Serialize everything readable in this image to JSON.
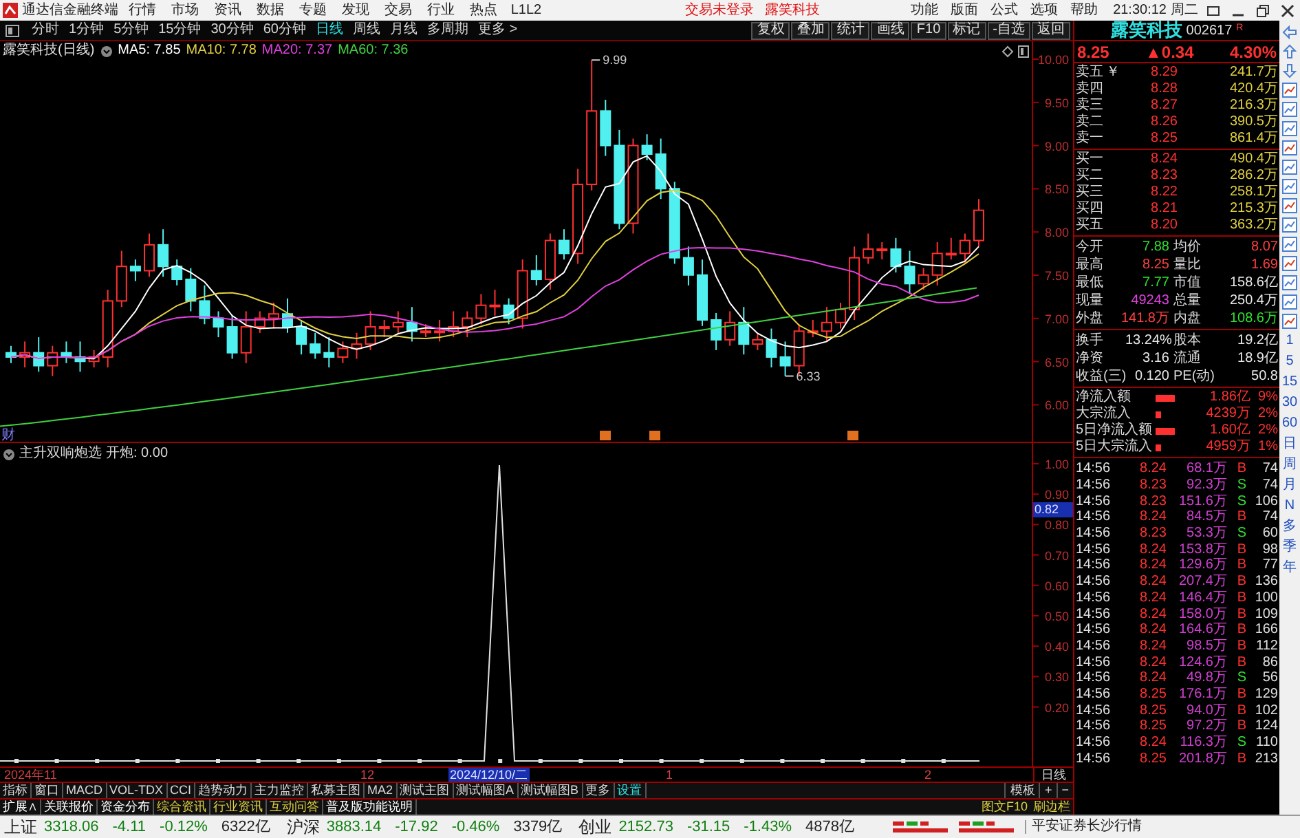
{
  "title_bar": {
    "app_title": "通达信金融终端",
    "menus": [
      "行情",
      "市场",
      "资讯",
      "数据",
      "专题",
      "发现",
      "交易",
      "行业",
      "热点",
      "L1L2"
    ],
    "trade_status": "交易未登录",
    "stock": "露笑科技",
    "right_menus": [
      "功能",
      "版面",
      "公式",
      "选项",
      "帮助"
    ],
    "time": "21:30:12",
    "weekday": "周二"
  },
  "period_tabs": [
    {
      "label": "分时",
      "selected": false
    },
    {
      "label": "1分钟",
      "selected": false
    },
    {
      "label": "5分钟",
      "selected": false
    },
    {
      "label": "15分钟",
      "selected": false
    },
    {
      "label": "30分钟",
      "selected": false
    },
    {
      "label": "60分钟",
      "selected": false
    },
    {
      "label": "日线",
      "selected": true
    },
    {
      "label": "周线",
      "selected": false
    },
    {
      "label": "月线",
      "selected": false
    },
    {
      "label": "多周期",
      "selected": false
    },
    {
      "label": "更多 >",
      "selected": false
    }
  ],
  "chart_tools": [
    "复权",
    "叠加",
    "统计",
    "画线",
    "F10",
    "标记",
    "-自选",
    "返回"
  ],
  "kline": {
    "title": "露笑科技(日线)",
    "ma": [
      {
        "label": "MA5: 7.85",
        "color": "#ffffff"
      },
      {
        "label": "MA10: 7.78",
        "color": "#e0d040"
      },
      {
        "label": "MA20: 7.37",
        "color": "#e040e0"
      },
      {
        "label": "MA60: 7.36",
        "color": "#40d040"
      }
    ],
    "high_label": "9.99",
    "low_label": "6.33",
    "price_axis": [
      "10.00",
      "9.50",
      "9.00",
      "8.50",
      "8.00",
      "7.50",
      "7.00",
      "6.50",
      "6.00"
    ],
    "marker": "财"
  },
  "indicator": {
    "title": "主升双响炮选",
    "reading": "开炮: 0.00",
    "axis": [
      "1.00",
      "0.90",
      "0.80",
      "0.70",
      "0.60",
      "0.50",
      "0.40",
      "0.30",
      "0.20"
    ],
    "cursor_value": "0.82"
  },
  "date_axis": {
    "year": "2024年",
    "months": [
      "11",
      "12",
      "1",
      "2"
    ],
    "cursor_date": "2024/12/10/二",
    "period": "日线"
  },
  "indicator_tabs": [
    {
      "label": "指标",
      "selected": false
    },
    {
      "label": "窗口",
      "selected": false
    },
    {
      "label": "MACD",
      "selected": false
    },
    {
      "label": "VOL-TDX",
      "selected": false
    },
    {
      "label": "CCI",
      "selected": false
    },
    {
      "label": "趋势动力",
      "selected": false
    },
    {
      "label": "主力监控",
      "selected": false
    },
    {
      "label": "私募主图",
      "selected": false
    },
    {
      "label": "MA2",
      "selected": false
    },
    {
      "label": "测试主图",
      "selected": false
    },
    {
      "label": "测试幅图A",
      "selected": false
    },
    {
      "label": "测试幅图B",
      "selected": false
    },
    {
      "label": "更多",
      "selected": false
    },
    {
      "label": "设置",
      "selected": true
    }
  ],
  "tab_buttons": [
    "模板",
    "+",
    "−"
  ],
  "info_tabs": [
    {
      "label": "扩展∧",
      "highlighted": false
    },
    {
      "label": "关联报价",
      "highlighted": false
    },
    {
      "label": "资金分布",
      "highlighted": false
    },
    {
      "label": "综合资讯",
      "highlighted": true
    },
    {
      "label": "行业资讯",
      "highlighted": true
    },
    {
      "label": "互动问答",
      "highlighted": true
    },
    {
      "label": "普及版功能说明",
      "highlighted": false
    }
  ],
  "info_right": [
    "图文F10",
    "刷边栏"
  ],
  "quote": {
    "name": "露笑科技",
    "code": "002617",
    "flag": "R",
    "price": "8.25",
    "change": "▲0.34",
    "percent": "4.30%",
    "currency": "￥",
    "asks": [
      {
        "label": "卖五",
        "price": "8.29",
        "volume": "241.7万"
      },
      {
        "label": "卖四",
        "price": "8.28",
        "volume": "420.4万"
      },
      {
        "label": "卖三",
        "price": "8.27",
        "volume": "216.3万"
      },
      {
        "label": "卖二",
        "price": "8.26",
        "volume": "390.5万"
      },
      {
        "label": "卖一",
        "price": "8.25",
        "volume": "861.4万"
      }
    ],
    "bids": [
      {
        "label": "买一",
        "price": "8.24",
        "volume": "490.4万"
      },
      {
        "label": "买二",
        "price": "8.23",
        "volume": "286.2万"
      },
      {
        "label": "买三",
        "price": "8.22",
        "volume": "258.1万"
      },
      {
        "label": "买四",
        "price": "8.21",
        "volume": "215.3万"
      },
      {
        "label": "买五",
        "price": "8.20",
        "volume": "363.2万"
      }
    ],
    "stats": [
      {
        "label": "今开",
        "value": "7.88",
        "color": "#30e030"
      },
      {
        "label": "均价",
        "value": "8.07",
        "color": "#ff4040"
      },
      {
        "label": "最高",
        "value": "8.25",
        "color": "#ff4040"
      },
      {
        "label": "量比",
        "value": "1.69",
        "color": "#ff4040"
      },
      {
        "label": "最低",
        "value": "7.77",
        "color": "#30e030"
      },
      {
        "label": "市值",
        "value": "158.6亿",
        "color": "#e8e8e8"
      },
      {
        "label": "现量",
        "value": "49243",
        "color": "#e040e0"
      },
      {
        "label": "总量",
        "value": "250.4万",
        "color": "#e8e8e8"
      },
      {
        "label": "外盘",
        "value": "141.8万",
        "color": "#ff4040"
      },
      {
        "label": "内盘",
        "value": "108.6万",
        "color": "#30e030"
      }
    ],
    "fundamentals": [
      {
        "label": "换手",
        "value": "13.24%",
        "label2": "股本",
        "value2": "19.2亿"
      },
      {
        "label": "净资",
        "value": "3.16",
        "label2": "流通",
        "value2": "18.9亿"
      },
      {
        "label": "收益(三)",
        "value": "0.120",
        "label2": "PE(动)",
        "value2": "50.8"
      }
    ],
    "flows": [
      {
        "label": "净流入额",
        "kind": "bar",
        "value": "1.86亿",
        "percent": "9%"
      },
      {
        "label": "大宗流入",
        "kind": "dot",
        "value": "4239万",
        "percent": "2%"
      },
      {
        "label": "5日净流入额",
        "kind": "bar",
        "value": "1.60亿",
        "percent": "2%"
      },
      {
        "label": "5日大宗流入",
        "kind": "dot",
        "value": "4959万",
        "percent": "1%"
      }
    ],
    "ticks": [
      {
        "time": "14:56",
        "price": "8.24",
        "volume": "68.1万",
        "side": "B",
        "count": "74"
      },
      {
        "time": "14:56",
        "price": "8.23",
        "volume": "92.3万",
        "side": "S",
        "count": "74"
      },
      {
        "time": "14:56",
        "price": "8.23",
        "volume": "151.6万",
        "side": "S",
        "count": "106"
      },
      {
        "time": "14:56",
        "price": "8.24",
        "volume": "84.5万",
        "side": "B",
        "count": "74"
      },
      {
        "time": "14:56",
        "price": "8.23",
        "volume": "53.3万",
        "side": "S",
        "count": "60"
      },
      {
        "time": "14:56",
        "price": "8.24",
        "volume": "153.8万",
        "side": "B",
        "count": "98"
      },
      {
        "time": "14:56",
        "price": "8.24",
        "volume": "129.6万",
        "side": "B",
        "count": "77"
      },
      {
        "time": "14:56",
        "price": "8.24",
        "volume": "207.4万",
        "side": "B",
        "count": "136"
      },
      {
        "time": "14:56",
        "price": "8.24",
        "volume": "146.4万",
        "side": "B",
        "count": "100"
      },
      {
        "time": "14:56",
        "price": "8.24",
        "volume": "158.0万",
        "side": "B",
        "count": "109"
      },
      {
        "time": "14:56",
        "price": "8.24",
        "volume": "164.6万",
        "side": "B",
        "count": "166"
      },
      {
        "time": "14:56",
        "price": "8.24",
        "volume": "98.5万",
        "side": "B",
        "count": "112"
      },
      {
        "time": "14:56",
        "price": "8.24",
        "volume": "124.6万",
        "side": "B",
        "count": "86"
      },
      {
        "time": "14:56",
        "price": "8.24",
        "volume": "49.8万",
        "side": "S",
        "count": "56"
      },
      {
        "time": "14:56",
        "price": "8.25",
        "volume": "176.1万",
        "side": "B",
        "count": "129"
      },
      {
        "time": "14:56",
        "price": "8.25",
        "volume": "94.0万",
        "side": "B",
        "count": "102"
      },
      {
        "time": "14:56",
        "price": "8.25",
        "volume": "97.2万",
        "side": "B",
        "count": "124"
      },
      {
        "time": "14:56",
        "price": "8.24",
        "volume": "116.3万",
        "side": "S",
        "count": "110"
      },
      {
        "time": "14:56",
        "price": "8.25",
        "volume": "201.8万",
        "side": "B",
        "count": "213"
      }
    ]
  },
  "side_periods": [
    "1",
    "5",
    "15",
    "30",
    "60",
    "日",
    "周",
    "月",
    "N",
    "多",
    "季",
    "年"
  ],
  "index_bar": [
    {
      "name": "上证",
      "value": "3318.06",
      "change": "-4.11",
      "percent": "-0.12%",
      "amount": "6322亿"
    },
    {
      "name": "沪深",
      "value": "3883.14",
      "change": "-17.92",
      "percent": "-0.46%",
      "amount": "3379亿"
    },
    {
      "name": "创业",
      "value": "2152.73",
      "change": "-31.15",
      "percent": "-1.43%",
      "amount": "4878亿"
    }
  ],
  "broker": "平安证券长沙行情"
}
